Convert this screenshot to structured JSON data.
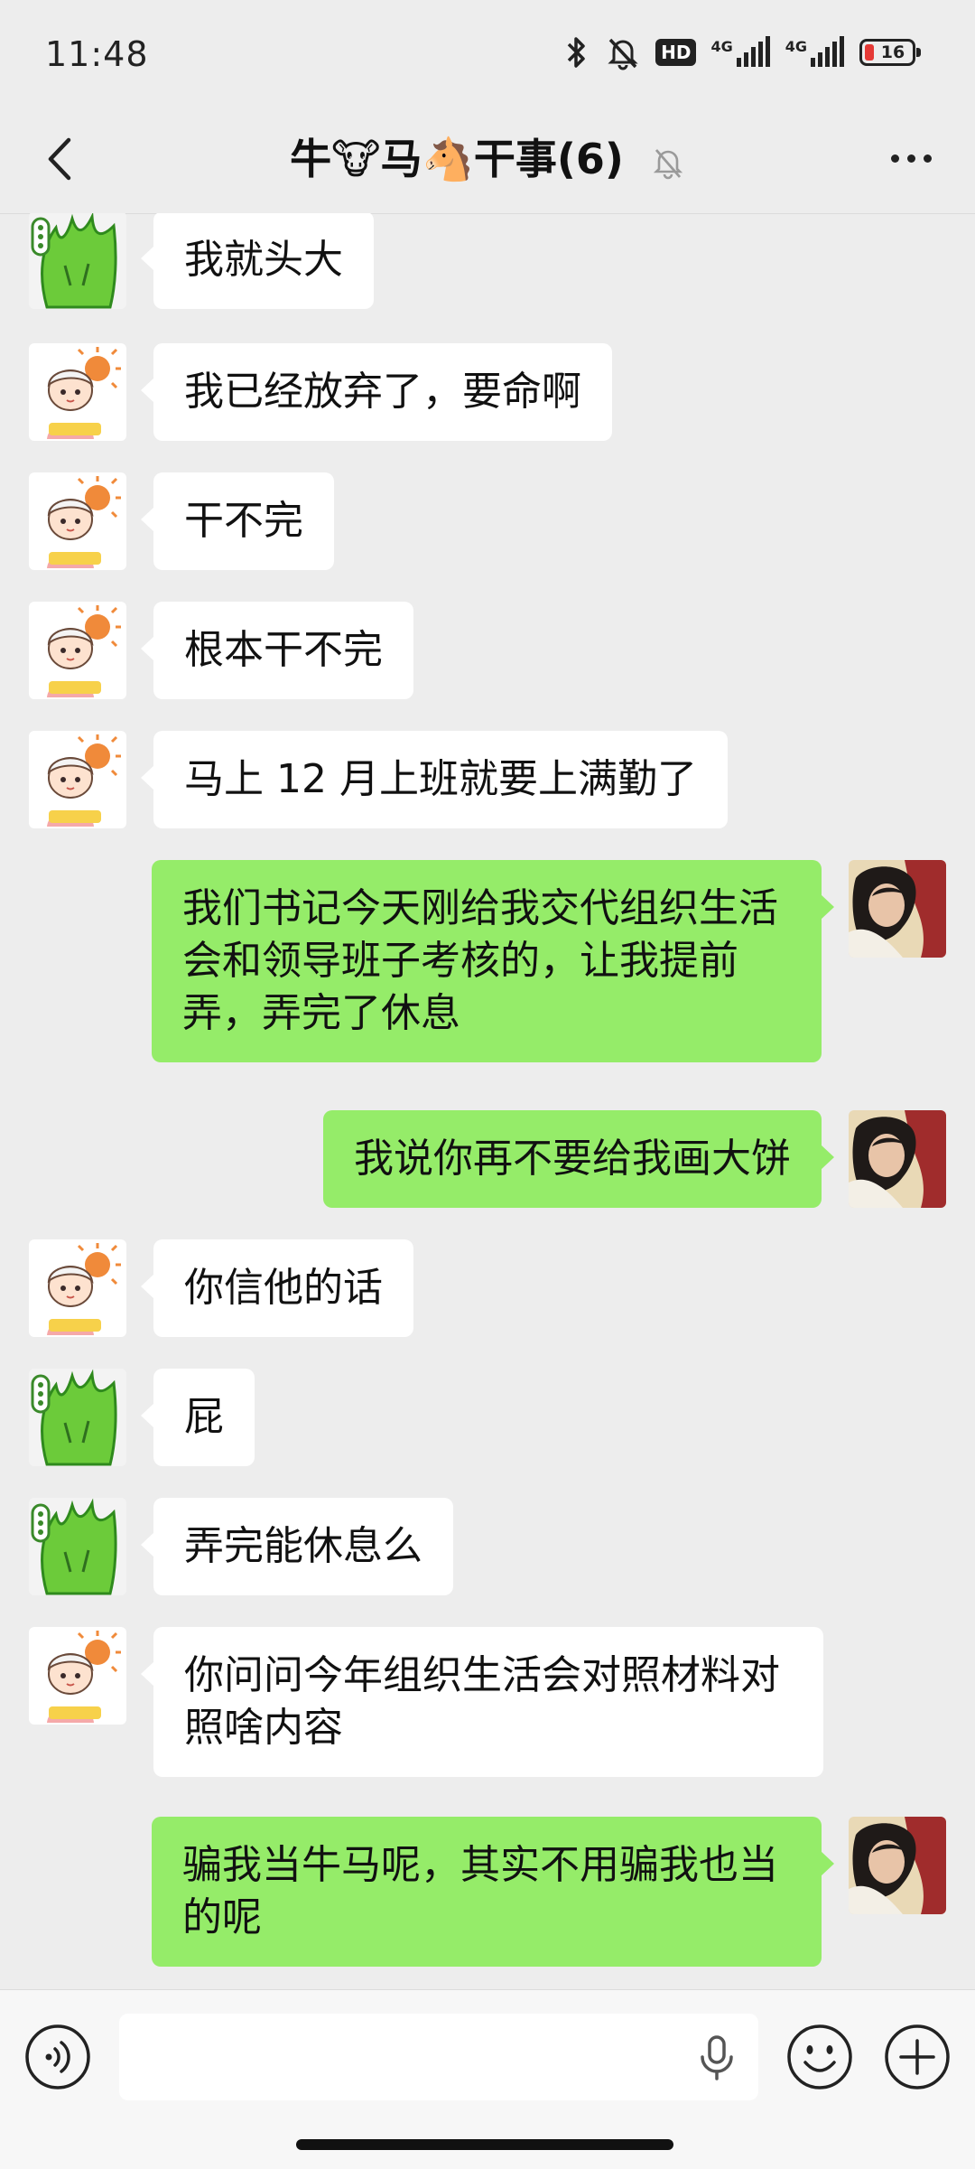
{
  "status_bar": {
    "time": "11:48",
    "hd_label": "HD",
    "net1": "4G",
    "net2": "4G",
    "battery": "16",
    "battery_color": "#e53935"
  },
  "header": {
    "title": "牛🐮马🐴干事(6)",
    "back_icon": "chevron-left-icon",
    "mute_icon": "bell-off-icon",
    "more_icon": "more-dots-icon"
  },
  "colors": {
    "background": "#ededed",
    "bubble_left": "#ffffff",
    "bubble_right": "#95ec69"
  },
  "messages": [
    {
      "side": "left",
      "avatar": "green-leaf-avatar",
      "text": "我就头大"
    },
    {
      "side": "left",
      "avatar": "boy-sun-avatar",
      "text": "我已经放弃了，要命啊"
    },
    {
      "side": "left",
      "avatar": "boy-sun-avatar",
      "text": "干不完"
    },
    {
      "side": "left",
      "avatar": "boy-sun-avatar",
      "text": "根本干不完"
    },
    {
      "side": "left",
      "avatar": "boy-sun-avatar",
      "text": "马上 12 月上班就要上满勤了"
    },
    {
      "side": "right",
      "avatar": "girl-photo-avatar",
      "text": "我们书记今天刚给我交代组织生活会和领导班子考核的，让我提前弄，弄完了休息"
    },
    {
      "side": "right",
      "avatar": "girl-photo-avatar",
      "text": "我说你再不要给我画大饼"
    },
    {
      "side": "left",
      "avatar": "boy-sun-avatar",
      "text": "你信他的话"
    },
    {
      "side": "left",
      "avatar": "green-leaf-avatar",
      "text": "屁"
    },
    {
      "side": "left",
      "avatar": "green-leaf-avatar",
      "text": "弄完能休息么"
    },
    {
      "side": "left",
      "avatar": "boy-sun-avatar",
      "text": "你问问今年组织生活会对照材料对照啥内容"
    },
    {
      "side": "right",
      "avatar": "girl-photo-avatar",
      "text": "骗我当牛马呢，其实不用骗我也当的呢"
    }
  ],
  "input_bar": {
    "voice_icon": "voice-icon",
    "mic_icon": "mic-icon",
    "emoji_icon": "emoji-icon",
    "plus_icon": "plus-icon",
    "input_value": ""
  }
}
